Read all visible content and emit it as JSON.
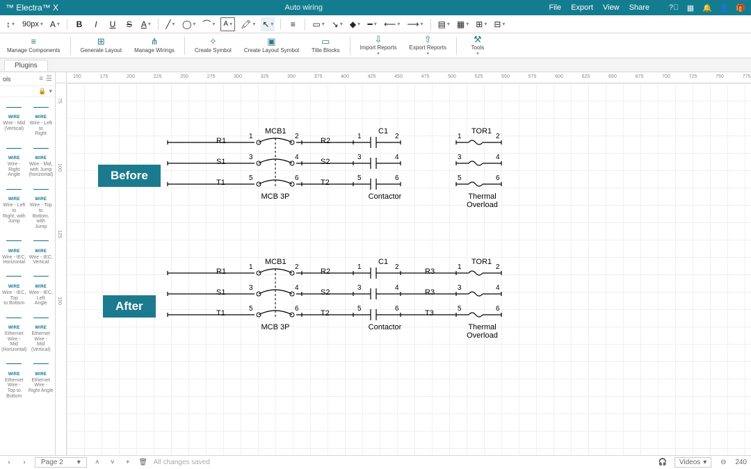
{
  "app": {
    "name": "™ Electra™ X",
    "doc_title": "Auto wiring"
  },
  "menu": {
    "file": "File",
    "export": "Export",
    "view": "View",
    "share": "Share"
  },
  "toolbar1": {
    "fontsize": "90px",
    "font_family_hint": "A▾",
    "bold": "B",
    "italic": "I",
    "underline": "U",
    "strike": "S"
  },
  "toolbar2": {
    "manage_components": "Manage\nComponents",
    "generate_layout": "Generate\nLayout",
    "manage_wirings": "Manage\nWirings",
    "create_symbol": "Create\nSymbol",
    "create_layout_symbol": "Create\nLayout Symbol",
    "title_blocks": "Title\nBlocks",
    "import_reports": "Import\nReports",
    "export_reports": "Export\nReports",
    "tools": "Tools"
  },
  "plugins_tab": "Plugins",
  "sidepanel": {
    "title": "ols",
    "items": [
      {
        "wire": "WIRE",
        "label": "Wire - Mid\n(Vertical)"
      },
      {
        "wire": "WIRE",
        "label": "Wire - Left to\nRight"
      },
      {
        "wire": "WIRE",
        "label": "Wire - Right\nAngle"
      },
      {
        "wire": "WIRE",
        "label": "Wire - Mid,\nwith Jump\n(horizontal)"
      },
      {
        "wire": "WIRE",
        "label": "Wire - Left to\nRight, with\nJump"
      },
      {
        "wire": "WIRE",
        "label": "Wire - Top to\nBottom, with\nJump"
      },
      {
        "wire": "WIRE",
        "label": "Wire - IEC,\nHorizontal"
      },
      {
        "wire": "WIRE",
        "label": "Wire - IEC,\nVertical"
      },
      {
        "wire": "WIRE",
        "label": "Wire - IEC, Top\nto Bottom"
      },
      {
        "wire": "WIRE",
        "label": "Wire - IEC, Left\nAngle"
      },
      {
        "wire": "WIRE",
        "label": "Ethernet Wire -\nMid\n(Horizontal)"
      },
      {
        "wire": "WIRE",
        "label": "Ethernet Wire -\nMid (Vertical)"
      },
      {
        "wire": "WIRE",
        "label": "Ethernet Wire -\nTop to Bottom"
      },
      {
        "wire": "WIRE",
        "label": "Ethernet Wire -\nRight Angle"
      }
    ]
  },
  "ruler_h": [
    150,
    175,
    200,
    225,
    250,
    275,
    300,
    325,
    350,
    375,
    400,
    425,
    450,
    475,
    500,
    525,
    550,
    575,
    600,
    625,
    650,
    675,
    700,
    725,
    750,
    775
  ],
  "ruler_v": [
    75,
    100,
    125,
    150
  ],
  "diagram": {
    "before_label": "Before",
    "after_label": "After",
    "mcb_ref": "MCB1",
    "mcb_sub": "MCB 3P",
    "c_ref": "C1",
    "c_sub": "Contactor",
    "tor_ref": "TOR1",
    "tor_sub": "Thermal\nOverload",
    "rows_before": [
      {
        "l": "R1",
        "m": "R2"
      },
      {
        "l": "S1",
        "m": "S2"
      },
      {
        "l": "T1",
        "m": "T2"
      }
    ],
    "rows_after": [
      {
        "l": "R1",
        "m": "R2",
        "r": "R3"
      },
      {
        "l": "S1",
        "m": "S2",
        "r": "R3"
      },
      {
        "l": "T1",
        "m": "T2",
        "r": "T3"
      }
    ],
    "pins_left": [
      "1",
      "3",
      "5"
    ],
    "pins_right": [
      "2",
      "4",
      "6"
    ]
  },
  "statusbar": {
    "page": "Page 2",
    "changes": "All changes saved",
    "zoom": "240",
    "videos": "Videos"
  }
}
